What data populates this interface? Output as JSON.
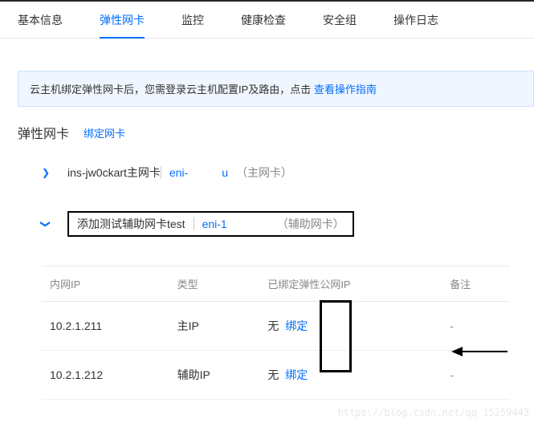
{
  "tabs": {
    "basic": "基本信息",
    "eni": "弹性网卡",
    "monitor": "监控",
    "health": "健康检查",
    "sg": "安全组",
    "oplog": "操作日志"
  },
  "tip": {
    "text_before": "云主机绑定弹性网卡后，您需登录云主机配置IP及路由，点击 ",
    "link": "查看操作指南"
  },
  "section": {
    "title": "弹性网卡",
    "bind_link": "绑定网卡"
  },
  "nic_primary": {
    "name": "ins-jw0ckart主网卡",
    "eni_prefix": "eni-",
    "eni_suffix": "u",
    "type": "（主网卡）"
  },
  "nic_secondary": {
    "name": "添加测试辅助网卡test",
    "eni": "eni-1",
    "type": "（辅助网卡）"
  },
  "table": {
    "headers": {
      "ip": "内网IP",
      "iptype": "类型",
      "eip": "已绑定弹性公网IP",
      "remark": "备注"
    },
    "rows": [
      {
        "ip": "10.2.1.211",
        "iptype": "主IP",
        "eip_none": "无",
        "eip_bind": "绑定",
        "remark": "-"
      },
      {
        "ip": "10.2.1.212",
        "iptype": "辅助IP",
        "eip_none": "无",
        "eip_bind": "绑定",
        "remark": "-"
      }
    ]
  },
  "watermark": "https://blog.csdn.net/qq_15259443"
}
